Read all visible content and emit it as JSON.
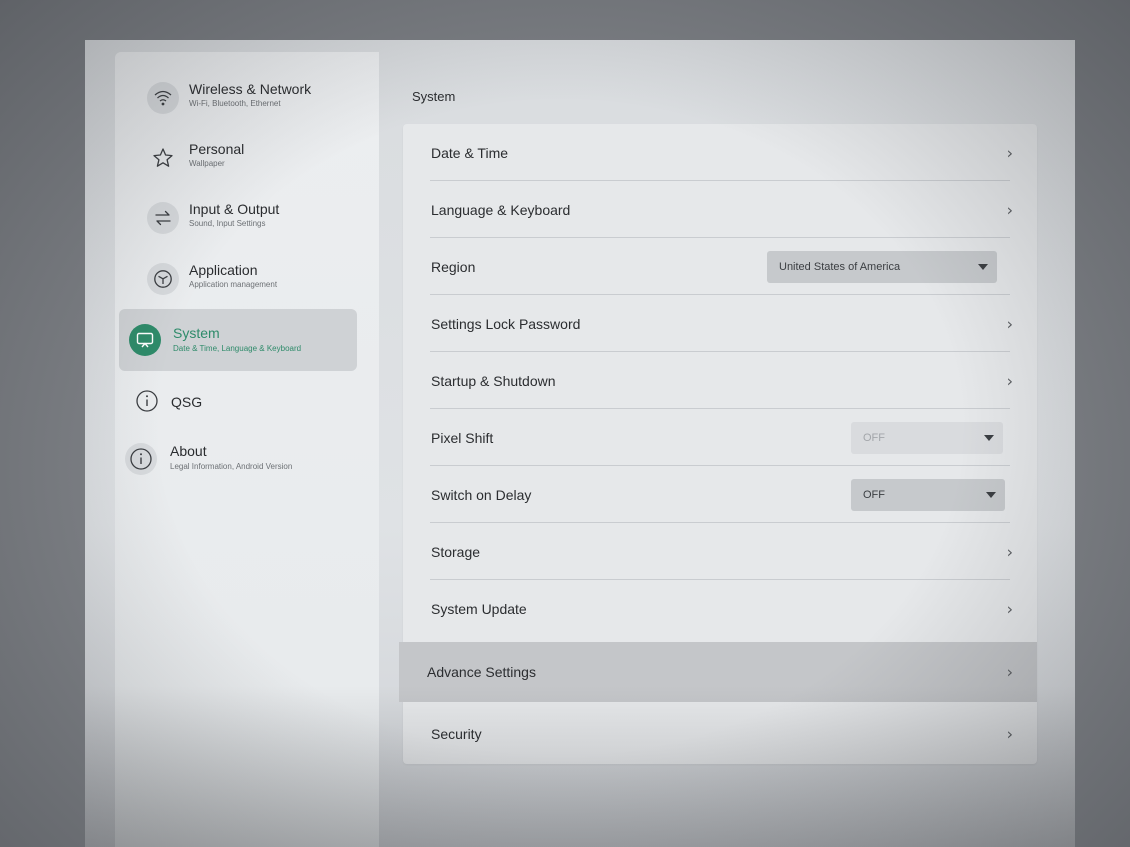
{
  "sidebar": {
    "items": [
      {
        "title": "Wireless & Network",
        "subtitle": "Wi-Fi, Bluetooth, Ethernet",
        "icon": "wifi-icon",
        "active": false
      },
      {
        "title": "Personal",
        "subtitle": "Wallpaper",
        "icon": "star-icon",
        "active": false
      },
      {
        "title": "Input & Output",
        "subtitle": "Sound, Input Settings",
        "icon": "swap-arrows-icon",
        "active": false
      },
      {
        "title": "Application",
        "subtitle": "Application management",
        "icon": "cube-icon",
        "active": false
      },
      {
        "title": "System",
        "subtitle": "Date & Time, Language & Keyboard",
        "icon": "monitor-icon",
        "active": true
      },
      {
        "title": "QSG",
        "subtitle": "",
        "icon": "info-icon",
        "active": false
      },
      {
        "title": "About",
        "subtitle": "Legal Information, Android Version",
        "icon": "info-icon",
        "active": false
      }
    ],
    "accent_color": "#2e8b6a"
  },
  "main": {
    "title": "System",
    "rows": [
      {
        "label": "Date & Time",
        "control": "chevron"
      },
      {
        "label": "Language & Keyboard",
        "control": "chevron"
      },
      {
        "label": "Region",
        "control": "dropdown",
        "value": "United States of America"
      },
      {
        "label": "Settings Lock Password",
        "control": "chevron"
      },
      {
        "label": "Startup & Shutdown",
        "control": "chevron"
      },
      {
        "label": "Pixel Shift",
        "control": "dropdown",
        "value": "OFF",
        "disabled": true
      },
      {
        "label": "Switch on Delay",
        "control": "dropdown",
        "value": "OFF"
      },
      {
        "label": "Storage",
        "control": "chevron"
      },
      {
        "label": "System Update",
        "control": "chevron"
      },
      {
        "label": "Advance Settings",
        "control": "chevron",
        "highlighted": true
      },
      {
        "label": "Security",
        "control": "chevron"
      }
    ],
    "chevron_glyph": "›"
  }
}
